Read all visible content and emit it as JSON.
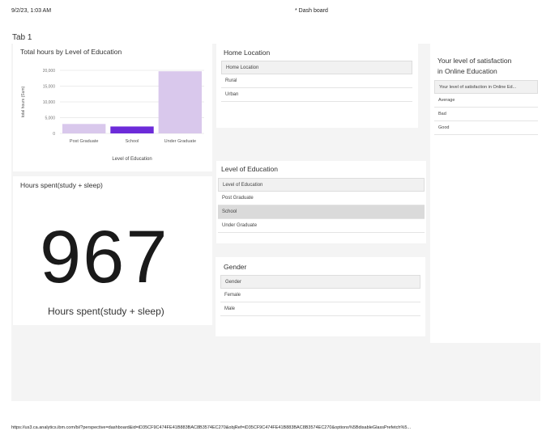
{
  "header": {
    "timestamp": "9/2/23, 1:03 AM",
    "title": "* Dash board"
  },
  "tab": {
    "label": "Tab 1"
  },
  "bar_card": {
    "title": "Total hours by Level of Education"
  },
  "chart_data": {
    "type": "bar",
    "title": "Total hours by Level of Education",
    "xlabel": "Level of Education",
    "ylabel": "total hours (Sum)",
    "categories": [
      "Post Graduate",
      "School",
      "Under Graduate"
    ],
    "values": [
      3000,
      2200,
      19700
    ],
    "ylim": [
      0,
      20000
    ],
    "yticks": [
      "0",
      "5,000",
      "10,000",
      "15,000",
      "20,000"
    ],
    "grid": true,
    "colors": [
      "#d9c8ec",
      "#6c2bd9",
      "#d9c8ec"
    ]
  },
  "home_location": {
    "title": "Home Location",
    "header": "Home Location",
    "rows": [
      "Rural",
      "Urban"
    ]
  },
  "satisfaction": {
    "title_line1": "Your level of satisfaction",
    "title_line2": "in Online Education",
    "header": "Your level of satisfaction in Online Ed...",
    "rows": [
      "Average",
      "Bad",
      "Good"
    ]
  },
  "hours_card": {
    "title": "Hours spent(study + sleep)",
    "value": "967",
    "label": "Hours spent(study + sleep)"
  },
  "education": {
    "title": "Level of Education",
    "header": "Level of Education",
    "rows": [
      "Post Graduate",
      "School",
      "Under Graduate"
    ],
    "selected": "School"
  },
  "gender": {
    "title": "Gender",
    "header": "Gender",
    "rows": [
      "Female",
      "Male"
    ]
  },
  "footer": {
    "url": "https://us3.ca.analytics.ibm.com/bi/?perspective=dashboard&id=iD35CF9C474FE41B883BAC8B3574EC270&objRef=iD35CF9C474FE41B883BAC8B3574EC270&options%5BdisableGlassPrefetch%5..."
  }
}
